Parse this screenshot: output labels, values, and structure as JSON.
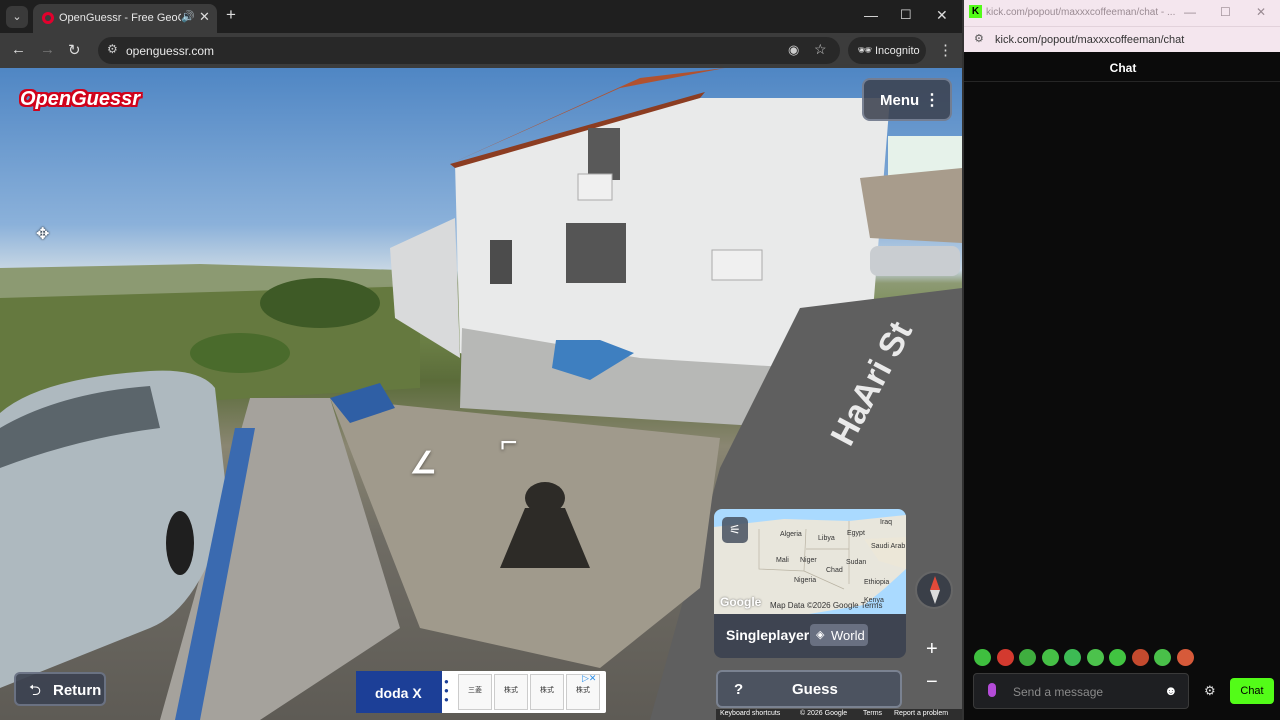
{
  "browser": {
    "tab_title": "OpenGuessr - Free GeoGuessr",
    "url": "openguessr.com",
    "incognito_label": "Incognito",
    "icons": [
      "tab-search-icon",
      "favicon-icon",
      "audio-icon",
      "close-icon",
      "plus-icon",
      "minimize-icon",
      "maximize-icon",
      "close-window-icon",
      "back-icon",
      "forward-icon",
      "reload-icon",
      "site-info-icon",
      "eye-off-icon",
      "star-icon",
      "incognito-icon",
      "kebab-icon"
    ]
  },
  "game": {
    "logo": "OpenGuessr",
    "menu_label": "Menu",
    "street_sign": "HaAri St",
    "mode_label": "Singleplayer",
    "map_scope": "World",
    "guess_label": "Guess",
    "guess_help": "?",
    "return_label": "Return",
    "minimap": {
      "labels": [
        "Algeria",
        "Libya",
        "Egypt",
        "Iraq",
        "Saudi Arab",
        "Mali",
        "Niger",
        "Chad",
        "Sudan",
        "Nigeria",
        "Ethiopia",
        "Kenya"
      ],
      "watermark": "Google",
      "attribution": "Map Data ©2026 Google   Terms"
    },
    "footer": {
      "shortcuts": "Keyboard shortcuts",
      "copyright": "© 2026 Google",
      "terms": "Terms",
      "report": "Report a problem"
    },
    "ad": {
      "brand": "doda X",
      "cards": [
        "三菱",
        "株式",
        "株式",
        "株式"
      ]
    },
    "colors": {
      "brand_red": "#d0021b",
      "panel": "#3c4250"
    }
  },
  "chat": {
    "window_title": "kick.com/popout/maxxxcoffeeman/chat - ...",
    "url": "kick.com/popout/maxxxcoffeeman/chat",
    "header": "Chat",
    "input_placeholder": "Send a message",
    "send_label": "Chat",
    "accent": "#53fc18",
    "emote_colors": [
      "#3fbf3f",
      "#d33a2f",
      "#3fae3f",
      "#46c046",
      "#3dbb54",
      "#4cc24c",
      "#41c441",
      "#c44a2e",
      "#49c049",
      "#d65a3a"
    ]
  }
}
